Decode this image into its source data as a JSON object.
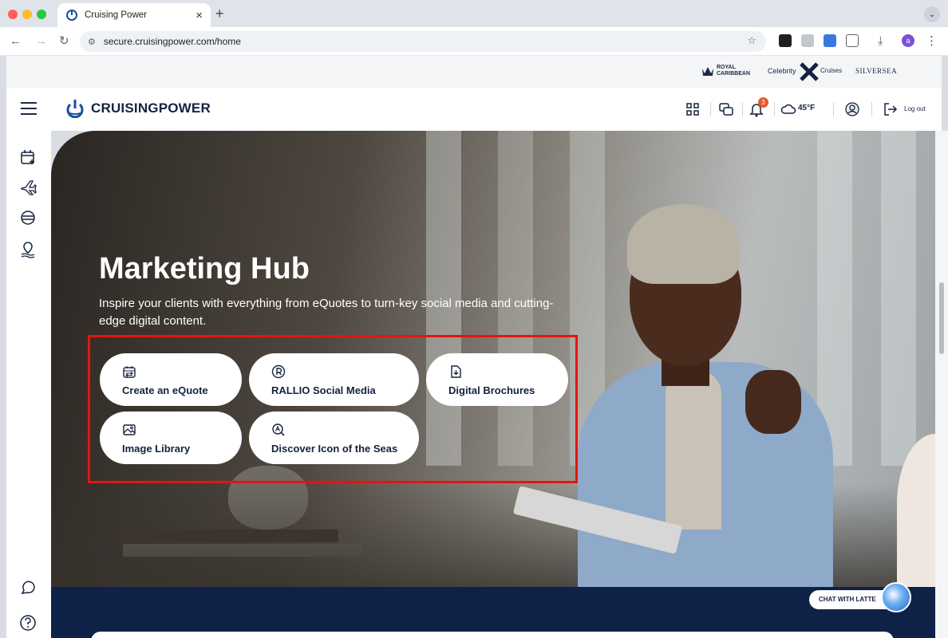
{
  "browser": {
    "tab_title": "Cruising Power",
    "tab_close": "×",
    "new_tab": "+",
    "url": "secure.cruisingpower.com/home",
    "profile_initial": "a"
  },
  "brands": {
    "royal_line1": "ROYAL",
    "royal_line2": "CARIBBEAN",
    "celebrity": "Celebrity",
    "cruises": "Cruises",
    "silversea": "SILVERSEA"
  },
  "header": {
    "logo_text": "CRUISINGPOWER",
    "notifications_count": "3",
    "temperature": "45°F",
    "logout_label": "Log out"
  },
  "hero": {
    "title": "Marketing Hub",
    "subtitle": "Inspire your clients with everything from eQuotes to turn-key social media and cutting-edge digital content.",
    "tiles": [
      {
        "label": "Create an eQuote",
        "icon": "calendar-exchange-icon"
      },
      {
        "label": "RALLIO Social Media",
        "icon": "rallio-icon"
      },
      {
        "label": "Digital Brochures",
        "icon": "document-download-icon"
      },
      {
        "label": "Image Library",
        "icon": "image-icon"
      },
      {
        "label": "Discover Icon of the Seas",
        "icon": "discover-search-icon"
      }
    ]
  },
  "chat": {
    "label": "CHAT WITH LATTE"
  },
  "colors": {
    "navy": "#15223f",
    "highlight": "#e8130f",
    "badge": "#e8572a"
  }
}
